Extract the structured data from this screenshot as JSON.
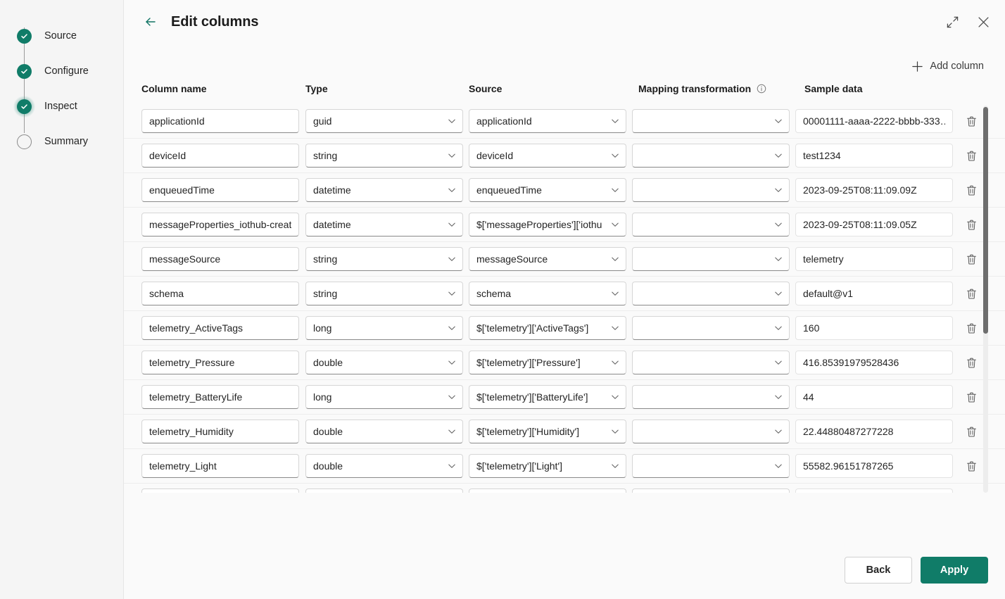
{
  "sidebar": {
    "steps": [
      {
        "label": "Source",
        "state": "done"
      },
      {
        "label": "Configure",
        "state": "done"
      },
      {
        "label": "Inspect",
        "state": "current"
      },
      {
        "label": "Summary",
        "state": "pending"
      }
    ]
  },
  "header": {
    "title": "Edit columns",
    "back_icon": "arrow-left-icon",
    "expand_icon": "expand-diagonal-icon",
    "close_icon": "close-icon"
  },
  "toolbar": {
    "add_column_label": "Add column",
    "add_icon": "plus-icon"
  },
  "table": {
    "headers": {
      "column_name": "Column name",
      "type": "Type",
      "source": "Source",
      "mapping_transformation": "Mapping transformation",
      "sample_data": "Sample data"
    },
    "mapping_info_icon": "info-icon",
    "delete_icon": "trash-icon",
    "chevron_icon": "chevron-down-icon",
    "rows": [
      {
        "column_name": "applicationId",
        "type": "guid",
        "source": "applicationId",
        "mapping_transformation": "",
        "sample_data": "00001111-aaaa-2222-bbbb-333…"
      },
      {
        "column_name": "deviceId",
        "type": "string",
        "source": "deviceId",
        "mapping_transformation": "",
        "sample_data": "test1234"
      },
      {
        "column_name": "enqueuedTime",
        "type": "datetime",
        "source": "enqueuedTime",
        "mapping_transformation": "",
        "sample_data": "2023-09-25T08:11:09.09Z"
      },
      {
        "column_name": "messageProperties_iothub-creat",
        "type": "datetime",
        "source": "$['messageProperties']['iothu",
        "mapping_transformation": "",
        "sample_data": "2023-09-25T08:11:09.05Z"
      },
      {
        "column_name": "messageSource",
        "type": "string",
        "source": "messageSource",
        "mapping_transformation": "",
        "sample_data": "telemetry"
      },
      {
        "column_name": "schema",
        "type": "string",
        "source": "schema",
        "mapping_transformation": "",
        "sample_data": "default@v1"
      },
      {
        "column_name": "telemetry_ActiveTags",
        "type": "long",
        "source": "$['telemetry']['ActiveTags']",
        "mapping_transformation": "",
        "sample_data": "160"
      },
      {
        "column_name": "telemetry_Pressure",
        "type": "double",
        "source": "$['telemetry']['Pressure']",
        "mapping_transformation": "",
        "sample_data": "416.85391979528436"
      },
      {
        "column_name": "telemetry_BatteryLife",
        "type": "long",
        "source": "$['telemetry']['BatteryLife']",
        "mapping_transformation": "",
        "sample_data": "44"
      },
      {
        "column_name": "telemetry_Humidity",
        "type": "double",
        "source": "$['telemetry']['Humidity']",
        "mapping_transformation": "",
        "sample_data": "22.44880487277228"
      },
      {
        "column_name": "telemetry_Light",
        "type": "double",
        "source": "$['telemetry']['Light']",
        "mapping_transformation": "",
        "sample_data": "55582.96151787265"
      },
      {
        "column_name": "",
        "type": "",
        "source": "",
        "mapping_transformation": "",
        "sample_data": ""
      }
    ]
  },
  "footer": {
    "back_label": "Back",
    "apply_label": "Apply"
  },
  "colors": {
    "accent": "#107c68",
    "sidebar_bg": "#f5f5f5",
    "panel_bg": "#fafafa",
    "text": "#242424"
  }
}
